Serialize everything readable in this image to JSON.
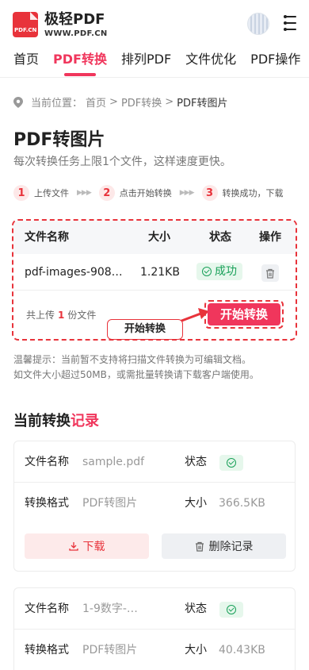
{
  "header": {
    "logo_text": "PDF.CN",
    "brand_name": "极轻PDF",
    "brand_url": "WWW.PDF.CN"
  },
  "nav": {
    "tabs": [
      {
        "label": "首页"
      },
      {
        "label": "PDF转换"
      },
      {
        "label": "排列PDF"
      },
      {
        "label": "文件优化"
      },
      {
        "label": "PDF操作"
      }
    ],
    "active": "PDF转换"
  },
  "breadcrumb": {
    "prefix": "当前位置：",
    "home": "首页",
    "sep1": ">",
    "section": "PDF转换",
    "sep2": ">",
    "current": "PDF转图片"
  },
  "page": {
    "title": "PDF转图片",
    "subtitle": "每次转换任务上限1个文件，这样速度更快。"
  },
  "steps": [
    {
      "num": "1",
      "label": "上传文件"
    },
    {
      "num": "2",
      "label": "点击开始转换"
    },
    {
      "num": "3",
      "label": "转换成功，下载"
    }
  ],
  "step_arrows": "▶▶▶",
  "file_table": {
    "headers": {
      "name": "文件名称",
      "size": "大小",
      "status": "状态",
      "action": "操作"
    },
    "row": {
      "name": "pdf-images-908…",
      "size": "1.21KB",
      "status": "成功"
    }
  },
  "upload": {
    "count_prefix": "共上传",
    "count": "1",
    "count_suffix": "份文件",
    "start_button": "开始转换",
    "tip_label": "开始转换"
  },
  "notice": {
    "line1": "温馨提示：当前暂不支持将扫描文件转换为可编辑文档。",
    "line2": "如文件大小超过50MB，或需批量转换请下载客户端使用。"
  },
  "records": {
    "title_main": "当前转换",
    "title_highlight": "记录",
    "labels": {
      "filename": "文件名称",
      "status": "状态",
      "format": "转换格式",
      "size": "大小",
      "download": "下载",
      "delete": "删除记录"
    },
    "items": [
      {
        "filename": "sample.pdf",
        "format": "PDF转图片",
        "size": "366.5KB"
      },
      {
        "filename": "1-9数字-…",
        "format": "PDF转图片",
        "size": "40.43KB"
      }
    ]
  },
  "colors": {
    "accent": "#f0365c",
    "brand_red": "#e8333b",
    "success": "#18a058"
  }
}
